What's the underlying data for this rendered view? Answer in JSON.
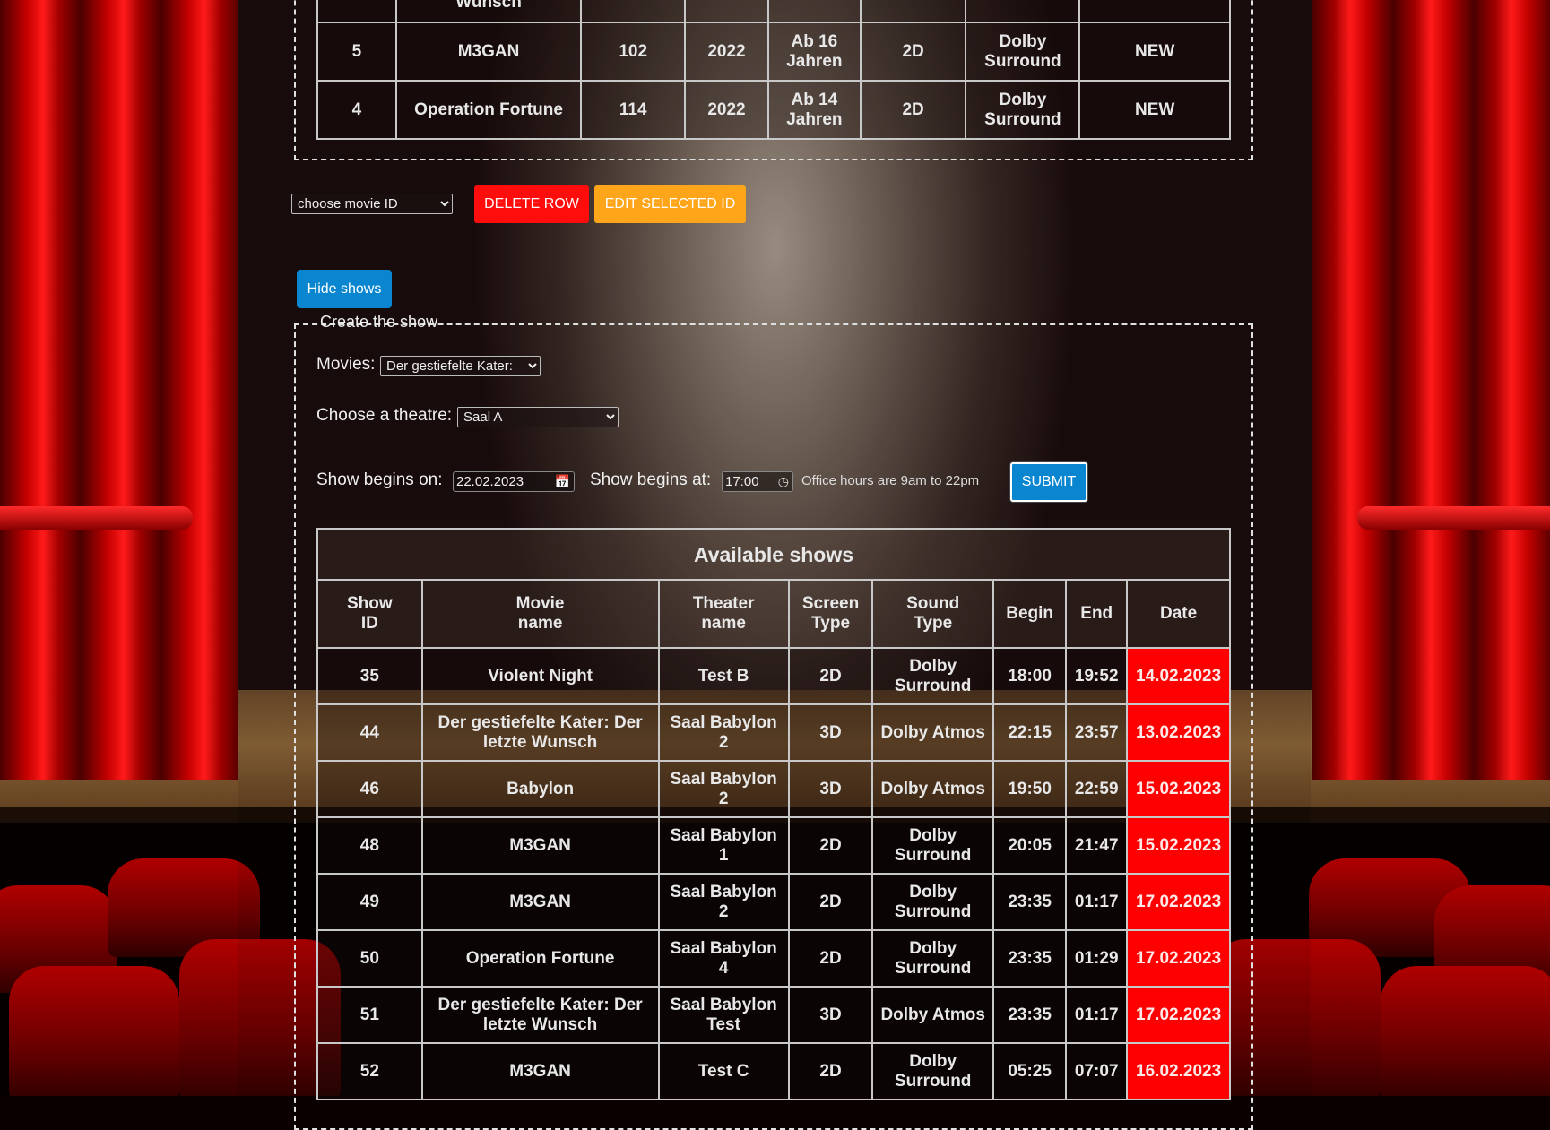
{
  "colors": {
    "delete": "#ff0d0d",
    "edit": "#ffa51a",
    "primary": "#0a86d1",
    "date_highlight": "#ff0000"
  },
  "movies_table": {
    "rows": [
      {
        "id": "",
        "name": "Wunsch",
        "duration": "",
        "year": "",
        "age": "",
        "screen": "",
        "sound": "",
        "status": ""
      },
      {
        "id": "5",
        "name": "M3GAN",
        "duration": "102",
        "year": "2022",
        "age": "Ab 16 Jahren",
        "screen": "2D",
        "sound": "Dolby Surround",
        "status": "NEW"
      },
      {
        "id": "4",
        "name": "Operation Fortune",
        "duration": "114",
        "year": "2022",
        "age": "Ab 14 Jahren",
        "screen": "2D",
        "sound": "Dolby Surround",
        "status": "NEW"
      }
    ]
  },
  "actions": {
    "movie_select": "choose movie ID",
    "delete_label": "DELETE ROW",
    "edit_label": "EDIT SELECTED ID",
    "hide_shows_label": "Hide shows"
  },
  "create_show": {
    "legend": "Create the show",
    "movies_label": "Movies:",
    "movies_value": "Der gestiefelte Kater:",
    "theatre_label": "Choose a theatre:",
    "theatre_value": "Saal A",
    "date_label": "Show begins on:",
    "date_value": "22.02.2023",
    "time_label": "Show begins at:",
    "time_value": "17:00",
    "hint": "Office hours are 9am to 22pm",
    "submit_label": "SUBMIT"
  },
  "shows_table": {
    "caption": "Available shows",
    "headers": [
      "Show ID",
      "Movie name",
      "Theater name",
      "Screen Type",
      "Sound Type",
      "Begin",
      "End",
      "Date"
    ],
    "rows": [
      {
        "id": "35",
        "movie": "Violent Night",
        "theater": "Test B",
        "screen": "2D",
        "sound": "Dolby Surround",
        "begin": "18:00",
        "end": "19:52",
        "date": "14.02.2023"
      },
      {
        "id": "44",
        "movie": "Der gestiefelte Kater: Der letzte Wunsch",
        "theater": "Saal Babylon 2",
        "screen": "3D",
        "sound": "Dolby Atmos",
        "begin": "22:15",
        "end": "23:57",
        "date": "13.02.2023"
      },
      {
        "id": "46",
        "movie": "Babylon",
        "theater": "Saal Babylon 2",
        "screen": "3D",
        "sound": "Dolby Atmos",
        "begin": "19:50",
        "end": "22:59",
        "date": "15.02.2023"
      },
      {
        "id": "48",
        "movie": "M3GAN",
        "theater": "Saal Babylon 1",
        "screen": "2D",
        "sound": "Dolby Surround",
        "begin": "20:05",
        "end": "21:47",
        "date": "15.02.2023"
      },
      {
        "id": "49",
        "movie": "M3GAN",
        "theater": "Saal Babylon 2",
        "screen": "2D",
        "sound": "Dolby Surround",
        "begin": "23:35",
        "end": "01:17",
        "date": "17.02.2023"
      },
      {
        "id": "50",
        "movie": "Operation Fortune",
        "theater": "Saal Babylon 4",
        "screen": "2D",
        "sound": "Dolby Surround",
        "begin": "23:35",
        "end": "01:29",
        "date": "17.02.2023"
      },
      {
        "id": "51",
        "movie": "Der gestiefelte Kater: Der letzte Wunsch",
        "theater": "Saal Babylon Test",
        "screen": "3D",
        "sound": "Dolby Atmos",
        "begin": "23:35",
        "end": "01:17",
        "date": "17.02.2023"
      },
      {
        "id": "52",
        "movie": "M3GAN",
        "theater": "Test C",
        "screen": "2D",
        "sound": "Dolby Surround",
        "begin": "05:25",
        "end": "07:07",
        "date": "16.02.2023"
      }
    ]
  }
}
